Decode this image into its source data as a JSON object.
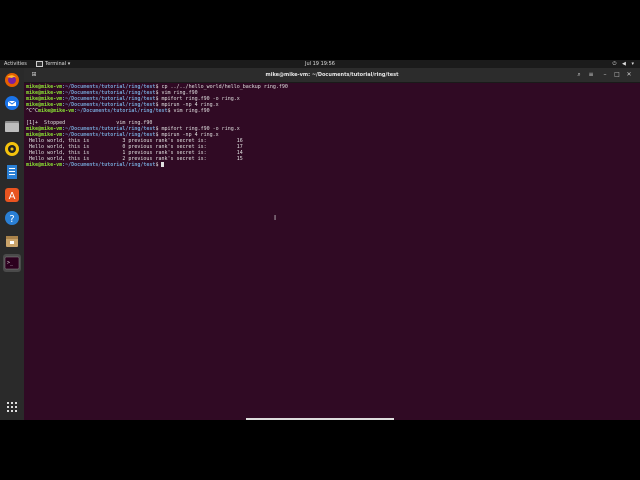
{
  "topbar": {
    "activities": "Activities",
    "app_menu": "Terminal ▾",
    "clock": "Jul 19  19:56",
    "tray": "⏻ ◀ ▾"
  },
  "window": {
    "title": "mike@mike-vm: ~/Documents/tutorial/ring/test"
  },
  "dock": {
    "items": [
      "firefox-icon",
      "thunderbird-icon",
      "files-icon",
      "rhythmbox-icon",
      "libreoffice-writer-icon",
      "app-center-icon",
      "help-icon",
      "package-icon",
      "terminal-icon"
    ]
  },
  "terminal": {
    "prompt_user": "mike@mike-vm",
    "prompt_path": ":~/Documents/tutorial/ring/test",
    "lines": [
      {
        "type": "cmd",
        "prefix": "",
        "cmd": "$ cp ../../hello_world/hello_backup ring.f90"
      },
      {
        "type": "cmd",
        "prefix": "",
        "cmd": "$ vim ring.f90"
      },
      {
        "type": "cmd",
        "prefix": "",
        "cmd": "$ mpifort ring.f90 -o ring.x"
      },
      {
        "type": "cmd",
        "prefix": "",
        "cmd": "$ mpirun -np 4 ring.x"
      },
      {
        "type": "cmd",
        "prefix": "^C^C",
        "cmd": "$ vim ring.f90"
      },
      {
        "type": "out",
        "text": ""
      },
      {
        "type": "out",
        "text": "[1]+  Stopped                 vim ring.f90"
      },
      {
        "type": "cmd",
        "prefix": "",
        "cmd": "$ mpifort ring.f90 -o ring.x"
      },
      {
        "type": "cmd",
        "prefix": "",
        "cmd": "$ mpirun -np 4 ring.x"
      },
      {
        "type": "out",
        "text": " Hello world, this is           3 previous rank's secret is:          16"
      },
      {
        "type": "out",
        "text": " Hello world, this is           0 previous rank's secret is:          17"
      },
      {
        "type": "out",
        "text": " Hello world, this is           1 previous rank's secret is:          14"
      },
      {
        "type": "out",
        "text": " Hello world, this is           2 previous rank's secret is:          15"
      },
      {
        "type": "prompt",
        "prefix": "",
        "cmd": "$ "
      }
    ]
  }
}
